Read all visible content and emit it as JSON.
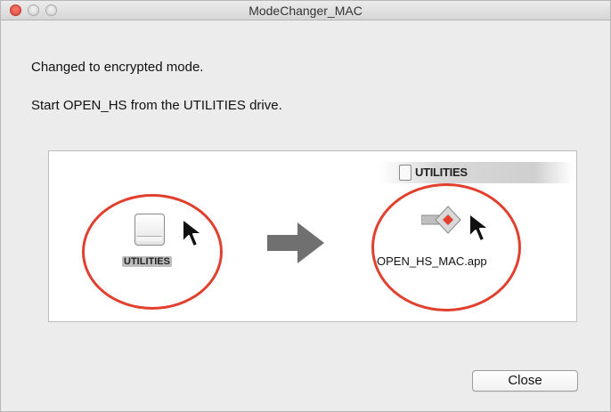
{
  "window": {
    "title": "ModeChanger_MAC",
    "traffic_lights": [
      "close",
      "minimize",
      "zoom"
    ]
  },
  "messages": {
    "line1": "Changed to encrypted mode.",
    "line2": "Start OPEN_HS from the UTILITIES drive."
  },
  "illustration": {
    "drive_header_label": "UTILITIES",
    "drive_icon_label": "UTILITIES",
    "app_label": "OPEN_HS_MAC.app",
    "highlight_color": "#e0402d"
  },
  "buttons": {
    "close_label": "Close"
  }
}
